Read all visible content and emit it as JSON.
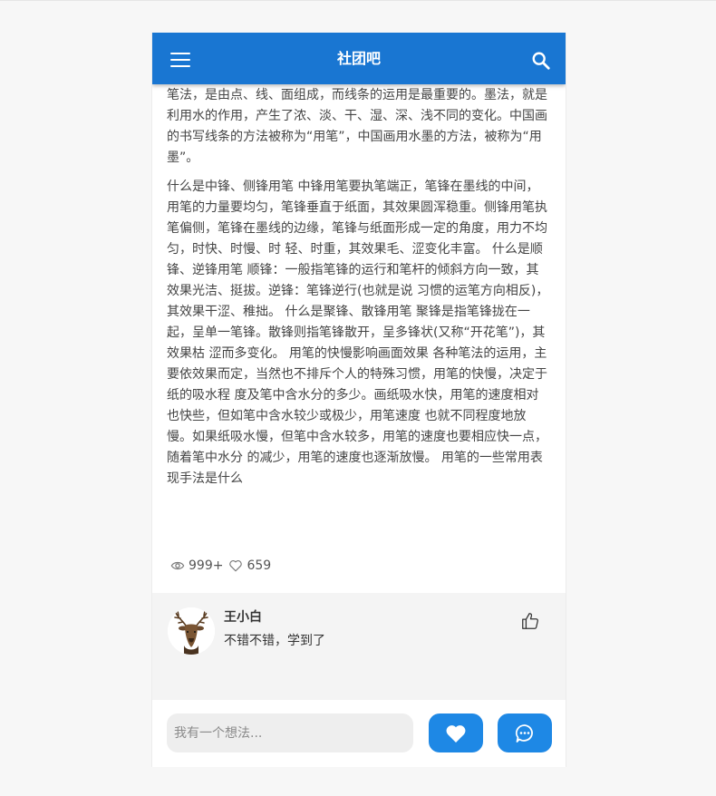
{
  "appbar": {
    "title": "社团吧",
    "menu_icon": "menu-icon",
    "search_icon": "search-icon",
    "color": "#1976d2"
  },
  "article": {
    "paragraphs": [
      "笔法，是由点、线、面组成，而线条的运用是最重要的。墨法，就是利用水的作用，产生了浓、淡、干、湿、深、浅不同的变化。中国画的书写线条的方法被称为“用笔”，中国画用水墨的方法，被称为“用墨”。",
      "什么是中锋、侧锋用笔 中锋用笔要执笔端正，笔锋在墨线的中间，用笔的力量要均匀，笔锋垂直于纸面，其效果圆浑稳重。侧锋用笔执笔偏侧，笔锋在墨线的边缘，笔锋与纸面形成一定的角度，用力不均匀，时快、时慢、时 轻、时重，其效果毛、涩变化丰富。 什么是顺锋、逆锋用笔 顺锋：一般指笔锋的运行和笔杆的倾斜方向一致，其效果光洁、挺拔。逆锋：笔锋逆行(也就是说 习惯的运笔方向相反)，其效果干涩、稚拙。 什么是聚锋、散锋用笔 聚锋是指笔锋拢在一起，呈单一笔锋。散锋则指笔锋散开，呈多锋状(又称“开花笔”)，其效果枯 涩而多变化。 用笔的快慢影响画面效果 各种笔法的运用，主要依效果而定，当然也不排斥个人的特殊习惯，用笔的快慢，决定于纸的吸水程 度及笔中含水分的多少。画纸吸水快，用笔的速度相对也快些，但如笔中含水较少或极少，用笔速度 也就不同程度地放慢。如果纸吸水慢，但笔中含水较多，用笔的速度也要相应快一点，随着笔中水分 的减少，用笔的速度也逐渐放慢。 用笔的一些常用表现手法是什么"
    ]
  },
  "stats": {
    "views": "999+",
    "likes": "659",
    "views_icon": "eye-icon",
    "likes_icon": "heart-outline-icon"
  },
  "comments": [
    {
      "name": "王小白",
      "text": "不错不错，学到了",
      "avatar_icon": "deer-avatar",
      "like_icon": "thumbs-up-icon"
    }
  ],
  "bottom_bar": {
    "input_placeholder": "我有一个想法...",
    "heart_icon": "heart-icon",
    "chat_icon": "chat-bubble-icon",
    "accent": "#1e88e5"
  }
}
